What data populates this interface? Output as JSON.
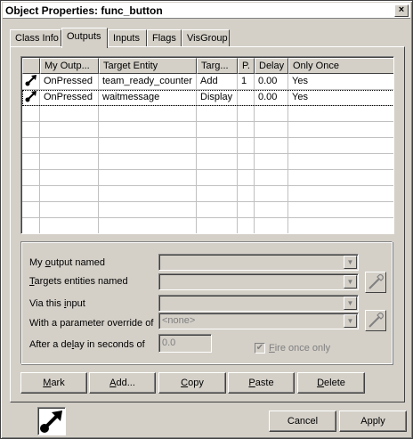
{
  "window": {
    "title": "Object Properties: func_button",
    "close_label": "×"
  },
  "tabs": [
    {
      "label": "Class Info"
    },
    {
      "label": "Outputs"
    },
    {
      "label": "Inputs"
    },
    {
      "label": "Flags"
    },
    {
      "label": "VisGroup"
    }
  ],
  "active_tab": "Outputs",
  "outputs_list": {
    "columns": [
      "",
      "My Outp...",
      "Target Entity",
      "Targ...",
      "P.",
      "Delay",
      "Only Once"
    ],
    "rows": [
      {
        "icon": "output-connection-icon",
        "output": "OnPressed",
        "target": "team_ready_counter",
        "input": "Add",
        "param": "1",
        "delay": "0.00",
        "once": "Yes"
      },
      {
        "icon": "output-connection-icon",
        "output": "OnPressed",
        "target": "waitmessage",
        "input": "Display",
        "param": "",
        "delay": "0.00",
        "once": "Yes"
      }
    ]
  },
  "details": {
    "output_label_pre": "My ",
    "output_label_u": "o",
    "output_label_post": "utput named",
    "targets_label_pre": "",
    "targets_label_u": "T",
    "targets_label_post": "argets entities named",
    "via_label_pre": "Via this ",
    "via_label_u": "i",
    "via_label_post": "nput",
    "param_label": "With a parameter override of",
    "param_value": "<none>",
    "delay_label_pre": "After a de",
    "delay_label_u": "l",
    "delay_label_post": "ay in seconds of",
    "delay_value": "0.0",
    "fire_once_pre": "",
    "fire_once_u": "F",
    "fire_once_post": "ire once only",
    "fire_once_checked": true
  },
  "buttons": {
    "mark_u": "M",
    "mark_post": "ark",
    "add_u": "A",
    "add_post": "dd...",
    "copy_u": "C",
    "copy_post": "opy",
    "paste_u": "P",
    "paste_post": "aste",
    "delete_u": "D",
    "delete_post": "elete",
    "cancel": "Cancel",
    "apply": "Apply"
  },
  "icons": {
    "row_icon": "output-connection-icon",
    "pick": "eyedropper-icon",
    "entity": "output-connection-icon"
  }
}
